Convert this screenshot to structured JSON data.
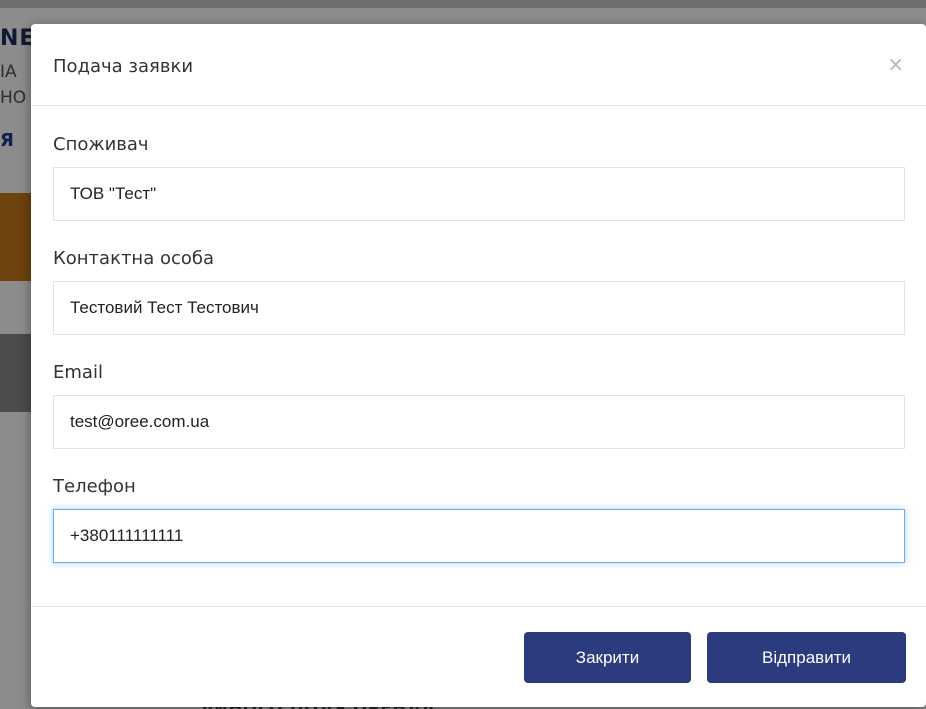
{
  "background": {
    "brand": "NE",
    "line1": "IA",
    "line2": "HO",
    "link": "Я",
    "bottom_text": "ЛИНОГО ПОЛЯ ОРЕНДА"
  },
  "modal": {
    "title": "Подача заявки",
    "close_glyph": "×",
    "fields": [
      {
        "label": "Споживач",
        "value": "ТОВ \"Тест\""
      },
      {
        "label": "Контактна особа",
        "value": "Тестовий Тест Тестович"
      },
      {
        "label": "Email",
        "value": "test@oree.com.ua"
      },
      {
        "label": "Телефон",
        "value": "+380111111111"
      }
    ],
    "buttons": {
      "close": "Закрити",
      "send": "Відправити"
    }
  },
  "colors": {
    "primary_button": "#2b3b7d",
    "focus_border": "#66afe9",
    "accent_orange": "#c87a1e"
  }
}
